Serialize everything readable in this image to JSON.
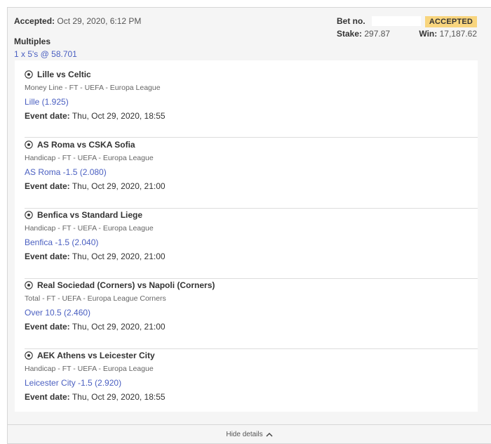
{
  "bet": {
    "accepted_label": "Accepted:",
    "accepted_time": "Oct 29, 2020, 6:12 PM",
    "type": "Multiples",
    "combo": "1 x 5's @ 58.701",
    "bet_no_label": "Bet no.",
    "status": "ACCEPTED",
    "stake_label": "Stake:",
    "stake_value": "297.87",
    "win_label": "Win:",
    "win_value": "17,187.62"
  },
  "selections": [
    {
      "match": "Lille vs Celtic",
      "market": "Money Line - FT - UEFA - Europa League",
      "pick": "Lille (1.925)",
      "date_label": "Event date:",
      "date": "Thu, Oct 29, 2020, 18:55"
    },
    {
      "match": "AS Roma vs CSKA Sofia",
      "market": "Handicap - FT - UEFA - Europa League",
      "pick": "AS Roma -1.5 (2.080)",
      "date_label": "Event date:",
      "date": "Thu, Oct 29, 2020, 21:00"
    },
    {
      "match": "Benfica vs Standard Liege",
      "market": "Handicap - FT - UEFA - Europa League",
      "pick": "Benfica -1.5 (2.040)",
      "date_label": "Event date:",
      "date": "Thu, Oct 29, 2020, 21:00"
    },
    {
      "match": "Real Sociedad (Corners) vs Napoli (Corners)",
      "market": "Total - FT - UEFA - Europa League Corners",
      "pick": "Over 10.5 (2.460)",
      "date_label": "Event date:",
      "date": "Thu, Oct 29, 2020, 21:00"
    },
    {
      "match": "AEK Athens vs Leicester City",
      "market": "Handicap - FT - UEFA - Europa League",
      "pick": "Leicester City -1.5 (2.920)",
      "date_label": "Event date:",
      "date": "Thu, Oct 29, 2020, 18:55"
    }
  ],
  "footer": {
    "hide_label": "Hide details",
    "icon": "chevron-up-icon"
  },
  "icons": {
    "sport": "soccer-ball-icon"
  },
  "colors": {
    "link": "#4a5fc1",
    "badge": "#f8d57e"
  }
}
